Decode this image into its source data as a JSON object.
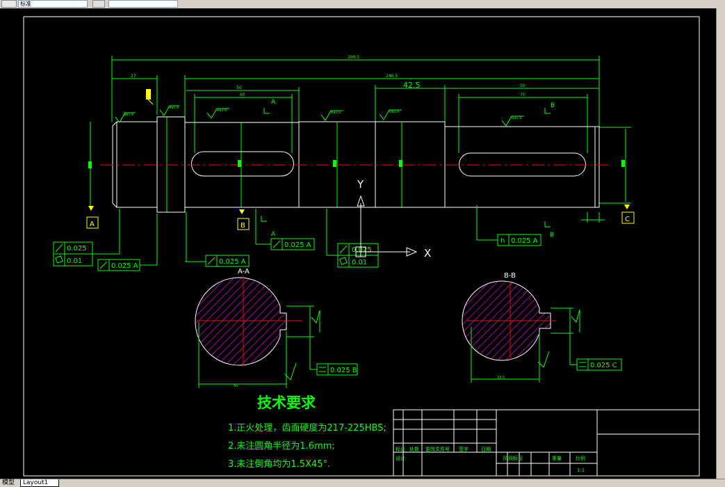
{
  "toolbar": {
    "layer_value": "标准",
    "field2_value": ""
  },
  "tabs": {
    "model": "模型",
    "layout1": "Layout1"
  },
  "drawing": {
    "dim_total": "299.5",
    "dim_27": "27",
    "dim_246": "246.5",
    "dim_425": "42.5",
    "dim_50a": "50",
    "dim_50b": "50",
    "dim_60": "60",
    "dim_70": "70",
    "rough": "Ra1.6",
    "datum_a": "A",
    "datum_b": "B",
    "datum_c": "C",
    "sec_a": "A",
    "sec_b": "B",
    "tol_0025": "0.025",
    "tol_0025a": "0.025 A",
    "tol_001": "0.01",
    "tol_0025b": "0.025 B",
    "tol_0025c": "0.025 C",
    "tol_h": "h",
    "axis_x": "X",
    "axis_y": "Y",
    "section_aa": "A-A",
    "section_bb": "B-B",
    "dim_sec1": "45",
    "dim_sec2": "33.5",
    "key_w1": "12",
    "key_w2": "10"
  },
  "tech": {
    "title": "技术要求",
    "line1": "1.正火处理，齿面硬度为217-225HBS;",
    "line2": "2.未注圆角半径为1.6mm;",
    "line3": "3.未注倒角均为1.5X45°."
  },
  "title_block": {
    "h1": "标记",
    "h2": "处数",
    "h3": "更改文件号",
    "h4": "签字",
    "h5": "日期",
    "h6": "设计",
    "h7": "阶段标记",
    "h8": "重量",
    "h9": "比例",
    "scale": "1:1"
  }
}
